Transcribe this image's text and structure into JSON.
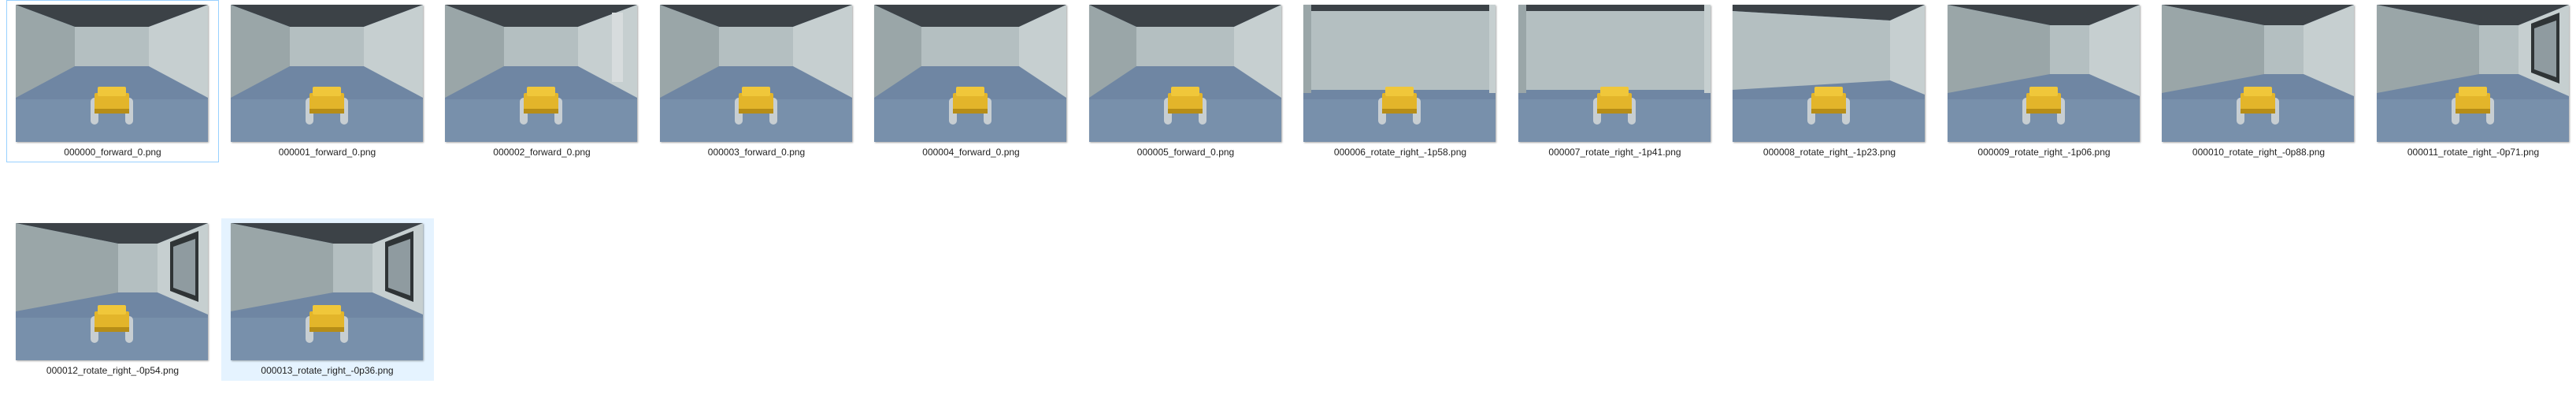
{
  "files": [
    {
      "name": "000000_forward_0.png",
      "state": "focused",
      "view": "forward"
    },
    {
      "name": "000001_forward_0.png",
      "state": "",
      "view": "forward"
    },
    {
      "name": "000002_forward_0.png",
      "state": "",
      "view": "forward-right-gap"
    },
    {
      "name": "000003_forward_0.png",
      "state": "",
      "view": "forward"
    },
    {
      "name": "000004_forward_0.png",
      "state": "",
      "view": "forward-wide"
    },
    {
      "name": "000005_forward_0.png",
      "state": "",
      "view": "forward-wide"
    },
    {
      "name": "000006_rotate_right_-1p58.png",
      "state": "",
      "view": "wall"
    },
    {
      "name": "000007_rotate_right_-1p41.png",
      "state": "",
      "view": "wall"
    },
    {
      "name": "000008_rotate_right_-1p23.png",
      "state": "",
      "view": "wall-corner"
    },
    {
      "name": "000009_rotate_right_-1p06.png",
      "state": "",
      "view": "corner"
    },
    {
      "name": "000010_rotate_right_-0p88.png",
      "state": "",
      "view": "corner"
    },
    {
      "name": "000011_rotate_right_-0p71.png",
      "state": "",
      "view": "corner-door"
    },
    {
      "name": "000012_rotate_right_-0p54.png",
      "state": "",
      "view": "corner-door"
    },
    {
      "name": "000013_rotate_right_-0p36.png",
      "state": "selected",
      "view": "corner-door"
    }
  ],
  "colors": {
    "ceiling": "#3c4247",
    "wall_back": "#b4bfc1",
    "wall_left": "#9aa6a8",
    "wall_right": "#c6cfd0",
    "floor": "#6f86a3",
    "robot": "#e3b52a",
    "wheel": "#c7ced2"
  }
}
